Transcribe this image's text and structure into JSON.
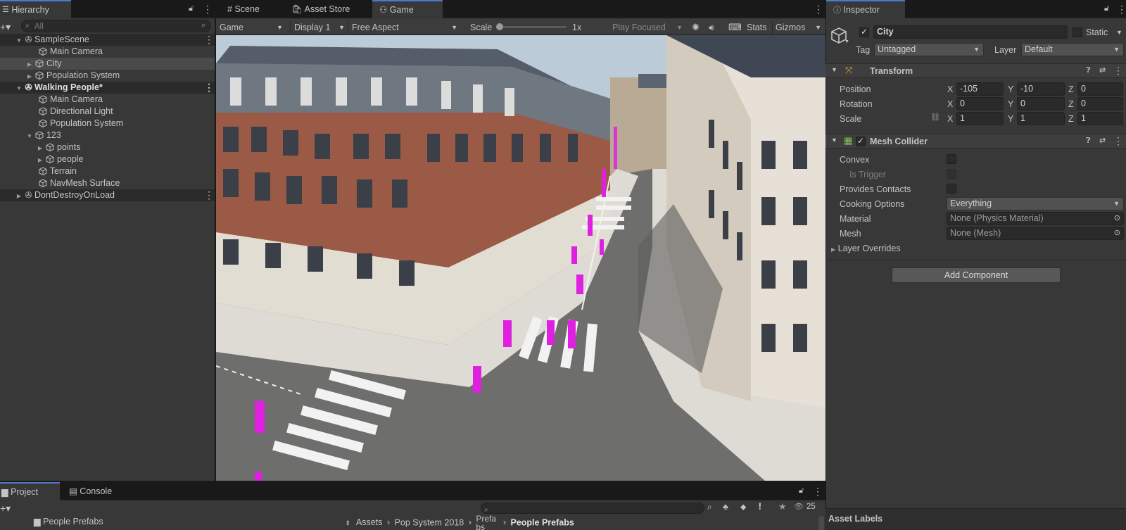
{
  "hierarchy": {
    "tab_label": "Hierarchy",
    "search_placeholder": "All",
    "items": [
      {
        "label": "SampleScene"
      },
      {
        "label": "Main Camera"
      },
      {
        "label": "City"
      },
      {
        "label": "Population System"
      },
      {
        "label": "Walking People*"
      },
      {
        "label": "Main Camera"
      },
      {
        "label": "Directional Light"
      },
      {
        "label": "Population System"
      },
      {
        "label": "123"
      },
      {
        "label": "points"
      },
      {
        "label": "people"
      },
      {
        "label": "Terrain"
      },
      {
        "label": "NavMesh Surface"
      },
      {
        "label": "DontDestroyOnLoad"
      }
    ]
  },
  "center_tabs": {
    "scene": "Scene",
    "asset_store": "Asset Store",
    "game": "Game"
  },
  "game_toolbar": {
    "display_mode": "Game",
    "display": "Display 1",
    "aspect": "Free Aspect",
    "scale_label": "Scale",
    "scale_value": "1x",
    "play_focused": "Play Focused",
    "stats": "Stats",
    "gizmos": "Gizmos"
  },
  "inspector": {
    "tab_label": "Inspector",
    "object_name": "City",
    "static_label": "Static",
    "tag_label": "Tag",
    "tag_value": "Untagged",
    "layer_label": "Layer",
    "layer_value": "Default",
    "transform": {
      "title": "Transform",
      "position_label": "Position",
      "rotation_label": "Rotation",
      "scale_label": "Scale",
      "position": {
        "x": "-105",
        "y": "-10",
        "z": "0"
      },
      "rotation": {
        "x": "0",
        "y": "0",
        "z": "0"
      },
      "scale": {
        "x": "1",
        "y": "1",
        "z": "1"
      },
      "axis_x": "X",
      "axis_y": "Y",
      "axis_z": "Z"
    },
    "mesh_collider": {
      "title": "Mesh Collider",
      "convex_label": "Convex",
      "is_trigger_label": "Is Trigger",
      "provides_contacts_label": "Provides Contacts",
      "cooking_options_label": "Cooking Options",
      "cooking_options_value": "Everything",
      "material_label": "Material",
      "material_value": "None (Physics Material)",
      "mesh_label": "Mesh",
      "mesh_value": "None (Mesh)",
      "layer_overrides_label": "Layer Overrides"
    },
    "add_component": "Add Component",
    "asset_labels": "Asset Labels"
  },
  "bottom": {
    "project_tab": "Project",
    "console_tab": "Console",
    "folder": "People Prefabs",
    "breadcrumb": [
      "Assets",
      "Pop System 2018",
      "Prefabs",
      "People Prefabs"
    ],
    "hidden_count": "25"
  },
  "colors": {
    "accent": "#4d78cc",
    "people": "#e020e0",
    "panel": "#383838",
    "dark": "#191919"
  }
}
